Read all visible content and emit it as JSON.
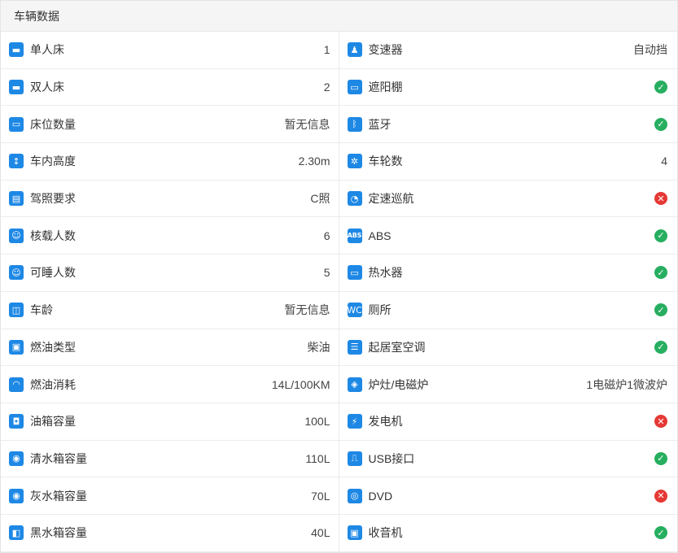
{
  "header": {
    "title": "车辆数据"
  },
  "left": [
    {
      "label": "单人床",
      "value": "1",
      "icon": "single-bed-icon",
      "glyph": "▬"
    },
    {
      "label": "双人床",
      "value": "2",
      "icon": "double-bed-icon",
      "glyph": "▬"
    },
    {
      "label": "床位数量",
      "value": "暂无信息",
      "icon": "bed-count-icon",
      "glyph": "▭"
    },
    {
      "label": "车内高度",
      "value": "2.30m",
      "icon": "height-icon",
      "glyph": "↕"
    },
    {
      "label": "驾照要求",
      "value": "C照",
      "icon": "license-icon",
      "glyph": "▤"
    },
    {
      "label": "核载人数",
      "value": "6",
      "icon": "passengers-icon",
      "glyph": "☺"
    },
    {
      "label": "可睡人数",
      "value": "5",
      "icon": "sleepers-icon",
      "glyph": "☺"
    },
    {
      "label": "车龄",
      "value": "暂无信息",
      "icon": "vehicle-age-icon",
      "glyph": "◫"
    },
    {
      "label": "燃油类型",
      "value": "柴油",
      "icon": "fuel-type-icon",
      "glyph": "▣"
    },
    {
      "label": "燃油消耗",
      "value": "14L/100KM",
      "icon": "fuel-consumption-icon",
      "glyph": "◠"
    },
    {
      "label": "油箱容量",
      "value": "100L",
      "icon": "fuel-tank-icon",
      "glyph": "◘"
    },
    {
      "label": "清水箱容量",
      "value": "110L",
      "icon": "fresh-water-tank-icon",
      "glyph": "◉"
    },
    {
      "label": "灰水箱容量",
      "value": "70L",
      "icon": "gray-water-tank-icon",
      "glyph": "◉"
    },
    {
      "label": "黑水箱容量",
      "value": "40L",
      "icon": "black-water-tank-icon",
      "glyph": "◧"
    }
  ],
  "right": [
    {
      "label": "变速器",
      "value": "自动挡",
      "icon": "transmission-icon",
      "glyph": "♟"
    },
    {
      "label": "遮阳棚",
      "status": "yes",
      "icon": "awning-icon",
      "glyph": "▭"
    },
    {
      "label": "蓝牙",
      "status": "yes",
      "icon": "bluetooth-icon",
      "glyph": "ᛒ"
    },
    {
      "label": "车轮数",
      "value": "4",
      "icon": "wheel-icon",
      "glyph": "✲"
    },
    {
      "label": "定速巡航",
      "status": "no",
      "icon": "cruise-control-icon",
      "glyph": "◔"
    },
    {
      "label": "ABS",
      "status": "yes",
      "icon": "abs-icon",
      "glyph": "ABS"
    },
    {
      "label": "热水器",
      "status": "yes",
      "icon": "water-heater-icon",
      "glyph": "▭"
    },
    {
      "label": "厕所",
      "status": "yes",
      "icon": "toilet-icon",
      "glyph": "WC"
    },
    {
      "label": "起居室空调",
      "status": "yes",
      "icon": "air-conditioner-icon",
      "glyph": "☰"
    },
    {
      "label": "炉灶/电磁炉",
      "value": "1电磁炉1微波炉",
      "icon": "stove-icon",
      "glyph": "◈"
    },
    {
      "label": "发电机",
      "status": "no",
      "icon": "generator-icon",
      "glyph": "⚡"
    },
    {
      "label": "USB接口",
      "status": "yes",
      "icon": "usb-port-icon",
      "glyph": "⎍"
    },
    {
      "label": "DVD",
      "status": "no",
      "icon": "dvd-icon",
      "glyph": "◎"
    },
    {
      "label": "收音机",
      "status": "yes",
      "icon": "radio-icon",
      "glyph": "▣"
    }
  ],
  "status_symbols": {
    "yes": "✓",
    "no": "✕"
  },
  "colors": {
    "icon_blue": "#1e88e5",
    "status_yes": "#27ae60",
    "status_no": "#e53935"
  }
}
